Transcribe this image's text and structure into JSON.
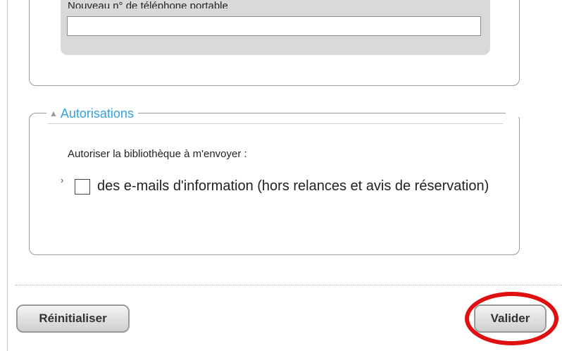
{
  "phone": {
    "label": "Nouveau n° de téléphone portable",
    "value": ""
  },
  "authorisations": {
    "legend": "Autorisations",
    "intro": "Autoriser la bibliothèque à m'envoyer :",
    "option_label": "des e-mails d'information (hors relances et avis de réservation)",
    "option_checked": false
  },
  "buttons": {
    "reset_label": "Réinitialiser",
    "submit_label": "Valider"
  },
  "colors": {
    "legend": "#3aa0d8",
    "highlight": "#e01010"
  }
}
